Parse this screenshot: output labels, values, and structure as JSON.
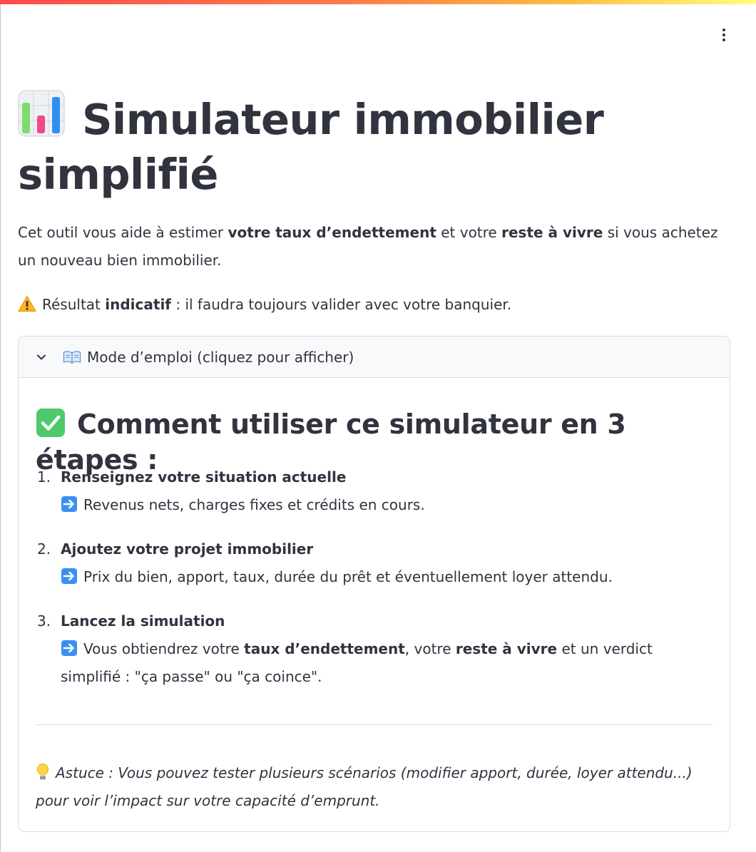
{
  "app": {
    "menu_icon": "kebab-menu-icon"
  },
  "header": {
    "title_icon": "bar-chart-icon",
    "title": "Simulateur immobilier simplifié"
  },
  "intro": {
    "t1": "Cet outil vous aide à estimer ",
    "b1": "votre taux d’endettement",
    "t2": " et votre ",
    "b2": "reste à vivre",
    "t3": " si vous achetez un nouveau bien immobilier."
  },
  "warning": {
    "icon": "warning-icon",
    "t1": "Résultat ",
    "b1": "indicatif",
    "t2": " : il faudra toujours valider avec votre banquier."
  },
  "expander": {
    "chevron_icon": "chevron-down-icon",
    "label_icon": "open-book-icon",
    "label": "Mode d’emploi (cliquez pour afficher)",
    "heading_icon": "check-mark-icon",
    "heading": "Comment utiliser ce simulateur en 3 étapes :",
    "steps": [
      {
        "num": "1.",
        "title": "Renseignez votre situation actuelle",
        "text": "Revenus nets, charges fixes et crédits en cours."
      },
      {
        "num": "2.",
        "title": "Ajoutez votre projet immobilier",
        "text": "Prix du bien, apport, taux, durée du prêt et éventuellement loyer attendu."
      },
      {
        "num": "3.",
        "title": "Lancez la simulation",
        "t1": "Vous obtiendrez votre ",
        "b1": "taux d’endettement",
        "t2": ", votre ",
        "b2": "reste à vivre",
        "t3": " et un verdict simplifié : \"ça passe\" ou \"ça coince\"."
      }
    ],
    "tip_icon": "light-bulb-icon",
    "tip": "Astuce : Vous pouvez tester plusieurs scénarios (modifier apport, durée, loyer attendu...) pour voir l’impact sur votre capacité d’emprunt."
  }
}
